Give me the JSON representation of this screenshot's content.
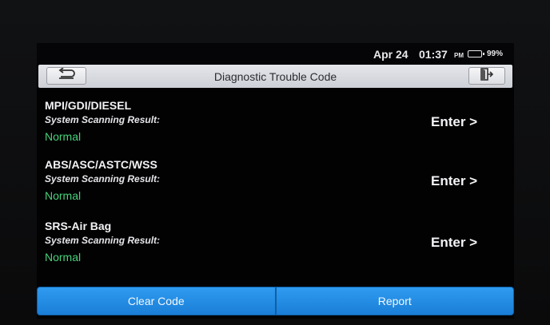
{
  "status": {
    "date": "Apr 24",
    "time": "01:37",
    "ampm": "PM",
    "battery_pct": "99%",
    "battery_level": 0.99
  },
  "header": {
    "title": "Diagnostic Trouble Code",
    "back_icon": "back-arrow-icon",
    "exit_icon": "exit-door-icon"
  },
  "systems": [
    {
      "name": "MPI/GDI/DIESEL",
      "subtitle": "System Scanning Result:",
      "status": "Normal",
      "action": "Enter >"
    },
    {
      "name": "ABS/ASC/ASTC/WSS",
      "subtitle": "System Scanning Result:",
      "status": "Normal",
      "action": "Enter >"
    },
    {
      "name": "SRS-Air Bag",
      "subtitle": "System Scanning Result:",
      "status": "Normal",
      "action": "Enter >"
    }
  ],
  "footer": {
    "clear_code": "Clear Code",
    "report": "Report"
  },
  "colors": {
    "status_normal": "#48d27a",
    "button_blue": "#1f88e0",
    "title_bar": "#d6d8dc"
  }
}
